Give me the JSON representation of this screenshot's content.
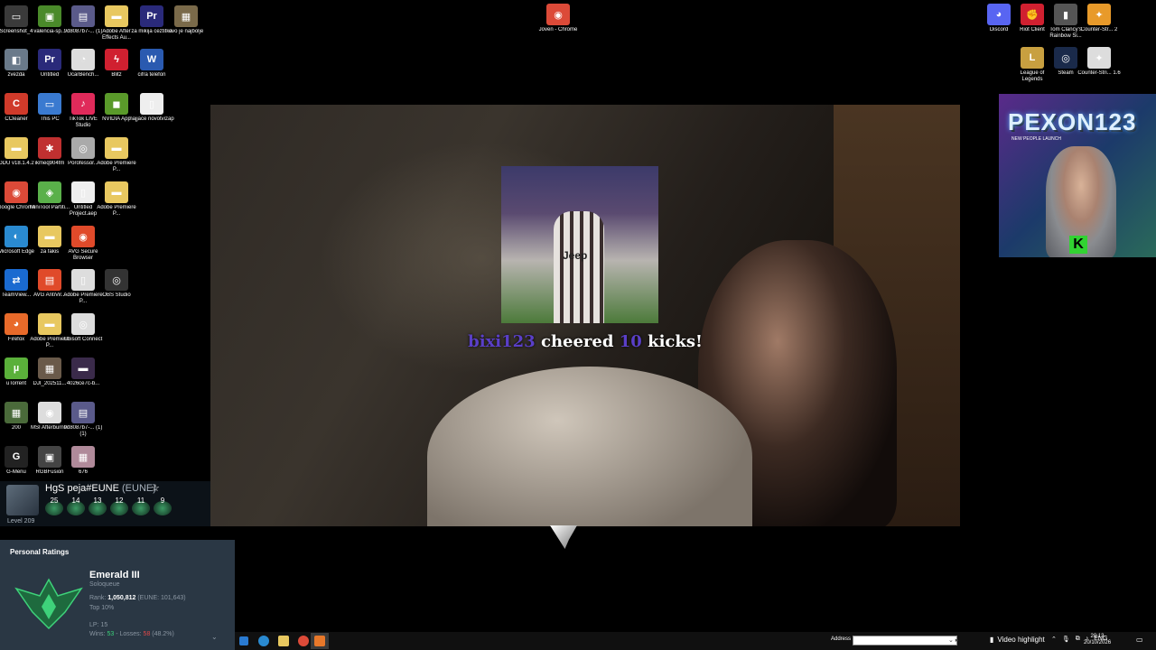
{
  "desktop_icons_left": [
    {
      "label": "Screenshot_4",
      "color": "#3a3a3a",
      "glyph": "▭"
    },
    {
      "label": "valencia-sp...",
      "color": "#4a8a2a",
      "glyph": "▣"
    },
    {
      "label": "9d8087b7-... (1)",
      "color": "#5a5a8a",
      "glyph": "▤"
    },
    {
      "label": "Adobe After Effects Au...",
      "color": "#e8c860",
      "glyph": "▬"
    },
    {
      "label": "za mikija ceztitka",
      "color": "#2a2a7a",
      "glyph": "Pr"
    },
    {
      "label": "ovo je najbolje",
      "color": "#7a6a4a",
      "glyph": "▦"
    },
    {
      "label": "zvezda",
      "color": "#6a7a8a",
      "glyph": "◧"
    },
    {
      "label": "Untitled",
      "color": "#2a2a7a",
      "glyph": "Pr"
    },
    {
      "label": "UcarBench...",
      "color": "#ddd",
      "glyph": "◔"
    },
    {
      "label": "Blitz",
      "color": "#d02030",
      "glyph": "ϟ"
    },
    {
      "label": "cifra telefon",
      "color": "#2a5ab0",
      "glyph": "W"
    },
    {
      "label": "CCleaner",
      "color": "#d03a2a",
      "glyph": "C"
    },
    {
      "label": "This PC",
      "color": "#3a7ad0",
      "glyph": "▭"
    },
    {
      "label": "TikTok LIVE Studio",
      "color": "#e02a5a",
      "glyph": "♪"
    },
    {
      "label": "NVIDIA App",
      "color": "#5a9a2a",
      "glyph": "◼"
    },
    {
      "label": "najjace novotvizap",
      "color": "#eee",
      "glyph": "▯"
    },
    {
      "label": "DDU v18.1.4.2",
      "color": "#e8c860",
      "glyph": "▬"
    },
    {
      "label": "ikmeq904fm",
      "color": "#c03030",
      "glyph": "✱"
    },
    {
      "label": "Porofessor...",
      "color": "#aaa",
      "glyph": "◎"
    },
    {
      "label": "Adobe Premiere P...",
      "color": "#e8c860",
      "glyph": "▬"
    },
    {
      "label": "Google Chrome",
      "color": "#dc4a38",
      "glyph": "◉"
    },
    {
      "label": "MiniTool Partiti...",
      "color": "#5ab04a",
      "glyph": "◈"
    },
    {
      "label": "Untitled Project.aep",
      "color": "#eee",
      "glyph": "▯"
    },
    {
      "label": "Adobe Premiere P...",
      "color": "#e8c860",
      "glyph": "▬"
    },
    {
      "label": "Microsoft Edge",
      "color": "#2a8ad0",
      "glyph": "◐"
    },
    {
      "label": "za fakis",
      "color": "#e8c860",
      "glyph": "▬"
    },
    {
      "label": "AVG Secure Browser",
      "color": "#e04a2a",
      "glyph": "◉"
    },
    {
      "label": "TeamView...",
      "color": "#1a6ad0",
      "glyph": "⇄"
    },
    {
      "label": "AVG AntiVir...",
      "color": "#e04a2a",
      "glyph": "▤"
    },
    {
      "label": "Adobe Premiere P...",
      "color": "#ddd",
      "glyph": "▯"
    },
    {
      "label": "OBS Studio",
      "color": "#333",
      "glyph": "◎"
    },
    {
      "label": "Firefox",
      "color": "#e86a2a",
      "glyph": "◕"
    },
    {
      "label": "Adobe Premiere P...",
      "color": "#e8c860",
      "glyph": "▬"
    },
    {
      "label": "Ubisoft Connect",
      "color": "#ddd",
      "glyph": "◎"
    },
    {
      "label": "uTorrent",
      "color": "#5ab03a",
      "glyph": "µ"
    },
    {
      "label": "DJI_202511...",
      "color": "#6a5a4a",
      "glyph": "▦"
    },
    {
      "label": "4026ce7c-b...",
      "color": "#3a2a4a",
      "glyph": "▬"
    },
    {
      "label": "200",
      "color": "#4a6a3a",
      "glyph": "▦"
    },
    {
      "label": "MSI Afterburner",
      "color": "#ddd",
      "glyph": "◉"
    },
    {
      "label": "9d8087b7-... (1) (1)",
      "color": "#5a5a8a",
      "glyph": "▤"
    },
    {
      "label": "G-Menu",
      "color": "#222",
      "glyph": "G"
    },
    {
      "label": "RGBFusion",
      "color": "#444",
      "glyph": "▣"
    },
    {
      "label": "676",
      "color": "#b08a9a",
      "glyph": "▦"
    }
  ],
  "desktop_icons_right": [
    {
      "label": "Joven - Chrome",
      "color": "#dc4a38",
      "glyph": "◉"
    },
    {
      "label": "Discord",
      "color": "#5865f2",
      "glyph": "◕"
    },
    {
      "label": "Riot Client",
      "color": "#d02030",
      "glyph": "✊"
    },
    {
      "label": "Tom Clancy's Rainbow Si...",
      "color": "#555",
      "glyph": "▮"
    },
    {
      "label": "Counter-Str... 2",
      "color": "#e89a2a",
      "glyph": "✦"
    },
    {
      "label": "League of Legends",
      "color": "#c8a040",
      "glyph": "L"
    },
    {
      "label": "Steam",
      "color": "#1a2a4a",
      "glyph": "◎"
    },
    {
      "label": "Counter-Stri... 1.6",
      "color": "#ddd",
      "glyph": "✦"
    }
  ],
  "stream": {
    "alert_username": "bixi123",
    "alert_cheered": "cheered",
    "alert_amount": "10",
    "alert_kicks": "kicks!",
    "alert_image_text": "Jeep"
  },
  "webcam": {
    "title": "PEXON123",
    "subtitle": "NEW PEOPLE LAUNCH",
    "badge": "K"
  },
  "league": {
    "summoner": "HgS peja#EUNE",
    "region": "(EUNE)",
    "level": "Level 209",
    "mastery_levels": [
      "25",
      "14",
      "13",
      "12",
      "11",
      "9"
    ],
    "personal_ratings_label": "Personal Ratings",
    "rank_name": "Emerald III",
    "queue": "Soloqueue",
    "rank_label": "Rank: ",
    "rank_value": "1,050,812",
    "rank_region": " (EUNE: 101,643)",
    "top": "Top 10%",
    "lp": "LP: 15",
    "wins_label": "Wins: ",
    "wins": "53",
    "losses_label": " - Losses: ",
    "losses": "58",
    "winrate": " (48.2%)"
  },
  "taskbar": {
    "address_label": "Address",
    "address_value": "",
    "video_highlight": "Video highlight",
    "language": "ENG",
    "time": "20:13",
    "date": "20/10/2026"
  }
}
